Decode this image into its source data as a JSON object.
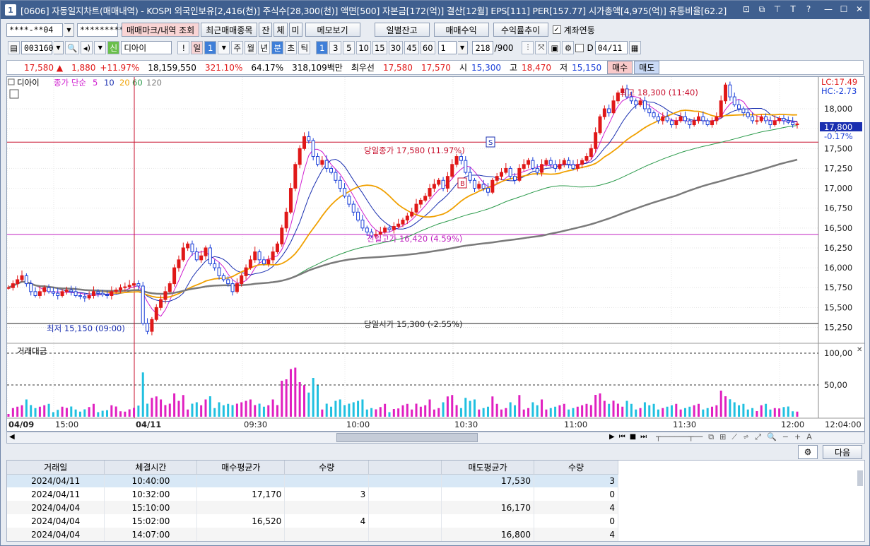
{
  "title": {
    "appnum": "1",
    "text": "[0606] 자동일지차트(매매내역) - KOSPI 외국인보유[2,416(천)] 주식수[28,300(천)] 액면[500] 자본금[172(억)] 결산[12월] EPS[111] PER[157.77] 시가총액[4,975(억)] 유통비율[62.2]"
  },
  "toolbar1": {
    "account": "****-**04",
    "password": "*********",
    "btn_trade": "매매마크/내역 조회",
    "btn_recent": "최근매매종목",
    "btn_jan": "잔",
    "btn_che": "체",
    "btn_mi": "미",
    "btn_memo": "메모보기",
    "btn_daily": "일별잔고",
    "btn_profit": "매매수익",
    "btn_rate": "수익률추이",
    "link_label": "계좌연동"
  },
  "toolbar2": {
    "code": "003160",
    "shin": "신",
    "name": "디아이",
    "excl": "!",
    "period_il": "일",
    "period_num": "1",
    "periods": [
      "주",
      "월",
      "년",
      "분",
      "초",
      "틱"
    ],
    "minutes": [
      "1",
      "3",
      "5",
      "10",
      "15",
      "30",
      "45",
      "60"
    ],
    "count": "1",
    "range": "218",
    "range_total": "/900",
    "d_label": "D",
    "date": "04/11"
  },
  "quote": {
    "price": "17,580",
    "arrow": "▲",
    "change": "1,880",
    "pct": "+11.97%",
    "volume": "18,159,550",
    "vol_ratio": "321.10%",
    "turnover": "64.17%",
    "amount": "318,109백만",
    "best_label": "최우선",
    "best_sell": "17,580",
    "best_buy": "17,570",
    "open_label": "시",
    "open": "15,300",
    "high_label": "고",
    "high": "18,470",
    "low_label": "저",
    "low": "15,150",
    "buy_btn": "매수",
    "sell_btn": "매도"
  },
  "chart_legend": {
    "name": "디아이",
    "ma_label": "종가 단순",
    "ma": [
      "5",
      "10",
      "20",
      "60",
      "120"
    ],
    "vol_label": "거래대금"
  },
  "annotations": {
    "prev_close": "당일종가 17,580 (11.97%)",
    "prev_high": "전일고가 16,420 (4.59%)",
    "open_line": "당일시가 15,300 (-2.55%)",
    "day_high": "최고 18,300 (11:40)",
    "day_low": "최저 15,150 (09:00)",
    "lc": "LC:17.49",
    "hc": "HC:-2.73",
    "cur_price": "17,800",
    "cur_pct": "-0.17%",
    "mark_s": "S",
    "mark_b": "B"
  },
  "colors": {
    "up": "#e01818",
    "down": "#1a3fd8",
    "ma5": "#d020d0",
    "ma10": "#1a2fb0",
    "ma20": "#f0a000",
    "ma60": "#2a9a4a",
    "ma120": "#7a7a7a"
  },
  "chart_data": {
    "type": "candlestick",
    "y_ticks": [
      "18,000",
      "17,750",
      "17,500",
      "17,250",
      "17,000",
      "16,750",
      "16,500",
      "16,250",
      "16,000",
      "15,750",
      "15,500",
      "15,250"
    ],
    "ylim": [
      15050,
      18400
    ],
    "x_ticks": [
      "04/09",
      "15:00",
      "04/11",
      "09:30",
      "10:00",
      "10:30",
      "11:00",
      "11:30",
      "12:00",
      "12:04:00"
    ],
    "vol_ticks": [
      "100,00",
      "50,00"
    ],
    "close_series": [
      15750,
      15800,
      15850,
      15900,
      15800,
      15700,
      15650,
      15700,
      15750,
      15700,
      15680,
      15650,
      15700,
      15720,
      15700,
      15650,
      15640,
      15620,
      15650,
      15700,
      15680,
      15660,
      15650,
      15700,
      15720,
      15750,
      15760,
      15780,
      15800,
      15770,
      15300,
      15200,
      15350,
      15500,
      15600,
      15700,
      15800,
      16000,
      16100,
      16250,
      16300,
      16200,
      16100,
      16150,
      16250,
      16050,
      16000,
      15900,
      15850,
      15800,
      15700,
      15800,
      15900,
      16000,
      16100,
      16200,
      16100,
      16050,
      16100,
      16200,
      16300,
      16500,
      16700,
      17000,
      17300,
      17500,
      17650,
      17600,
      17400,
      17300,
      17350,
      17250,
      17200,
      17100,
      17000,
      16900,
      16800,
      16700,
      16600,
      16500,
      16450,
      16400,
      16420,
      16450,
      16500,
      16480,
      16520,
      16550,
      16600,
      16650,
      16700,
      16800,
      16850,
      16900,
      17000,
      17050,
      17100,
      17000,
      17150,
      17300,
      17400,
      17350,
      17200,
      17100,
      17000,
      17050,
      17000,
      16950,
      17100,
      17150,
      17200,
      17250,
      17150,
      17100,
      17250,
      17300,
      17350,
      17250,
      17200,
      17300,
      17350,
      17300,
      17250,
      17300,
      17350,
      17300,
      17250,
      17300,
      17350,
      17400,
      17500,
      17700,
      17900,
      18000,
      17950,
      18100,
      18200,
      18250,
      18150,
      18100,
      18050,
      18100,
      18000,
      17950,
      17900,
      17850,
      17900,
      17850,
      17800,
      17850,
      17900,
      17850,
      17800,
      17850,
      17900,
      17850,
      17800,
      17850,
      17900,
      18100,
      18300,
      18150,
      18050,
      18000,
      17950,
      17900,
      17850,
      17850,
      17900,
      17850,
      17800,
      17850,
      17880,
      17850,
      17830,
      17800,
      17810
    ]
  },
  "grid": {
    "headers": [
      "거래일",
      "체결시간",
      "매수평균가",
      "수량",
      "",
      "매도평균가",
      "수량"
    ],
    "rows": [
      [
        "2024/04/11",
        "10:40:00",
        "",
        "",
        "",
        "17,530",
        "3"
      ],
      [
        "2024/04/11",
        "10:32:00",
        "17,170",
        "3",
        "",
        "",
        "0"
      ],
      [
        "2024/04/04",
        "15:10:00",
        "",
        "",
        "",
        "16,170",
        "4"
      ],
      [
        "2024/04/04",
        "15:02:00",
        "16,520",
        "4",
        "",
        "",
        "0"
      ],
      [
        "2024/04/04",
        "14:07:00",
        "",
        "",
        "",
        "16,800",
        "4"
      ]
    ],
    "next_btn": "다음"
  }
}
